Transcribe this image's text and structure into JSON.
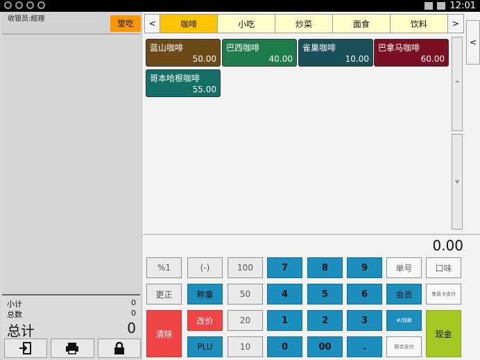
{
  "status": {
    "time": "12:01"
  },
  "left": {
    "cashier": "收银员:經理",
    "dine_in": "堂吃",
    "subtotal_label": "小计",
    "subtotal_value": "0",
    "count_label": "总数",
    "count_value": "0",
    "total_label": "总计",
    "total_value": "0"
  },
  "tabs": {
    "prev": "<",
    "next": ">",
    "items": [
      "咖啡",
      "小吃",
      "炒菜",
      "面食",
      "饮料"
    ]
  },
  "side": {
    "handle": "<",
    "up": "^",
    "down": "v"
  },
  "products": [
    {
      "name": "蓝山咖啡",
      "price": "50.00",
      "color": "#6b4a18"
    },
    {
      "name": "巴西咖啡",
      "price": "40.00",
      "color": "#1f7a4c"
    },
    {
      "name": "雀巢咖啡",
      "price": "10.00",
      "color": "#184f59"
    },
    {
      "name": "巴拿马咖啡",
      "price": "60.00",
      "color": "#7a1024"
    },
    {
      "name": "哥本哈根咖啡",
      "price": "55.00",
      "color": "#146f66"
    }
  ],
  "amount": "0.00",
  "keys": {
    "pct": "%1",
    "minus": "(-)",
    "k100": "100",
    "k7": "7",
    "k8": "8",
    "k9": "9",
    "order_no": "单号",
    "taste": "口味",
    "correct": "更正",
    "weigh": "称重",
    "k50": "50",
    "k4": "4",
    "k5": "5",
    "k6": "6",
    "member": "会员",
    "member_card": "會員卡支付",
    "clear": "清除",
    "change_price": "改价",
    "k20": "20",
    "k1": "1",
    "k2": "2",
    "k3": "3",
    "drawer": "#/钱箱",
    "plu": "PLU",
    "k10": "10",
    "k0": "0",
    "k00": "00",
    "dot": ".",
    "joint_pay": "联合支付",
    "cash": "现金"
  }
}
